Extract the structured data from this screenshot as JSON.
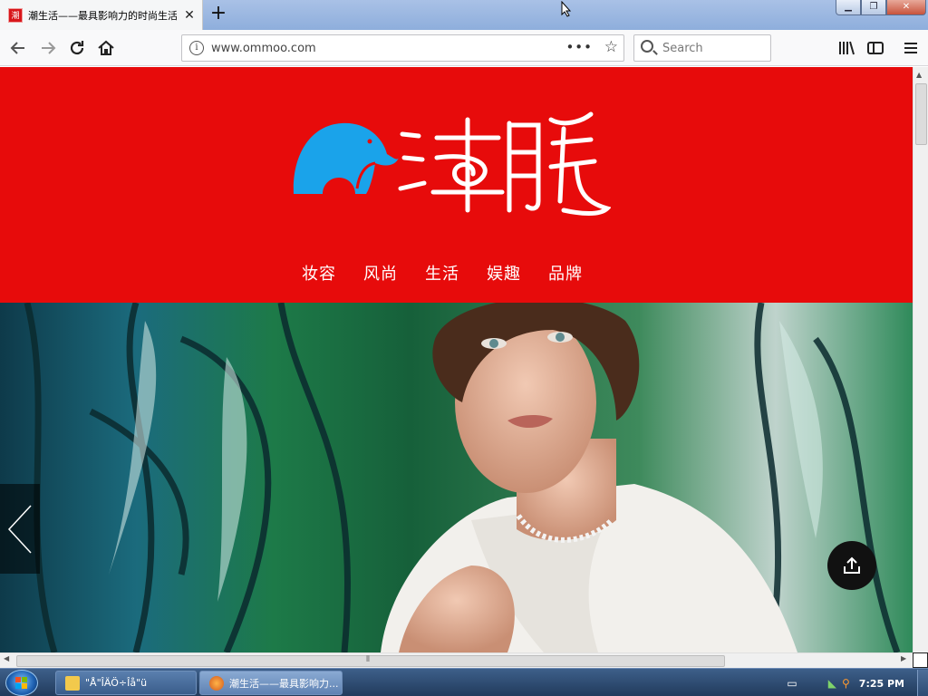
{
  "browser": {
    "tab_title": "潮生活——最具影响力的时尚生活",
    "tab_close": "✕",
    "new_tab": "+",
    "window_controls": {
      "minimize": "▁",
      "maximize": "❐",
      "close": "✕"
    },
    "url": "www.ommoo.com",
    "page_actions": "•••",
    "search_placeholder": "Search",
    "nav_icons": [
      "back-icon",
      "forward-icon",
      "reload-icon",
      "home-icon",
      "library-icon",
      "sidebar-icon",
      "menu-icon"
    ]
  },
  "page": {
    "logo_text": "潮",
    "nav": [
      "妆容",
      "风尚",
      "生活",
      "娱趣",
      "品牌"
    ],
    "colors": {
      "header_bg": "#e70b0b",
      "logo_elephant": "#1aa3ea",
      "nav_text": "#ffffff"
    }
  },
  "taskbar": {
    "items": [
      {
        "label": "\"Å\"ÎÄÖ÷Îå\"ü",
        "icon": "folder-icon"
      },
      {
        "label": "潮生活——最具影响力...",
        "icon": "firefox-icon"
      }
    ],
    "clock": "7:25 PM"
  }
}
